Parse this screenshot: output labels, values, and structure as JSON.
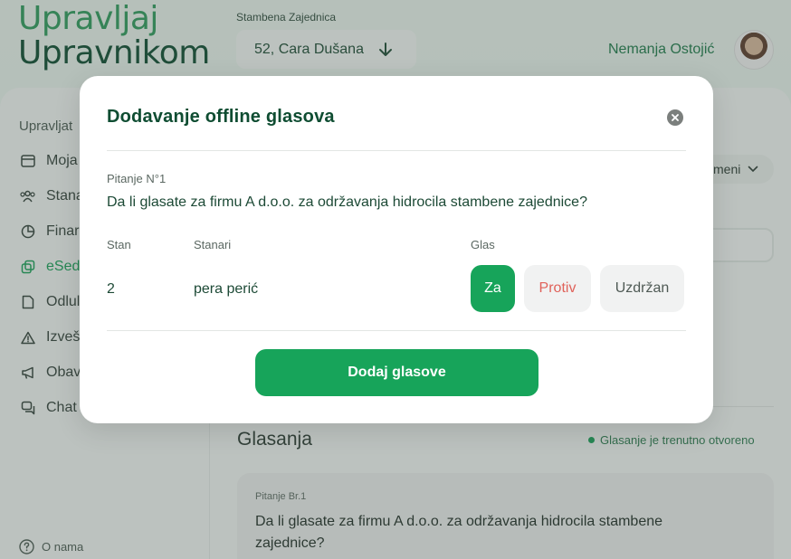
{
  "header": {
    "logo_line1": "Upravljaj",
    "logo_line2": "Upravnikom",
    "community_label": "Stambena Zajednica",
    "address": "52, Cara Dušana",
    "user_name": "Nemanja Ostojić"
  },
  "sidebar": {
    "title": "Upravljat",
    "items": [
      {
        "label": "Moja",
        "icon": "wallet-icon"
      },
      {
        "label": "Stana",
        "icon": "users-icon"
      },
      {
        "label": "Finar",
        "icon": "pie-chart-icon"
      },
      {
        "label": "eSed",
        "icon": "copy-icon"
      },
      {
        "label": "Odlul",
        "icon": "document-icon"
      },
      {
        "label": "Izveš",
        "icon": "warning-icon"
      },
      {
        "label": "Obav",
        "icon": "megaphone-icon"
      },
      {
        "label": "Chat",
        "icon": "chat-icon"
      }
    ],
    "about": "O nama"
  },
  "background": {
    "filter_label": "meni",
    "section_title": "Glasanja",
    "status_text": "Glasanje je trenutno otvoreno",
    "question_number": "Pitanje Br.1",
    "question_text": "Da li glasate za firmu A d.o.o. za održavanja hidrocila stambene zajednice?"
  },
  "modal": {
    "title": "Dodavanje offline glasova",
    "question_label": "Pitanje N°1",
    "question_text": "Da li glasate za firmu A d.o.o. za održavanja hidrocila stambene zajednice?",
    "columns": {
      "apartment": "Stan",
      "residents": "Stanari",
      "vote": "Glas"
    },
    "row": {
      "apartment": "2",
      "residents": "pera perić"
    },
    "vote_options": {
      "yes": "Za",
      "no": "Protiv",
      "abstain": "Uzdržan"
    },
    "selected_vote": "Za",
    "submit_label": "Dodaj glasove"
  },
  "colors": {
    "accent": "#17a45a",
    "title": "#0f4d32",
    "no_vote": "#e0625a"
  }
}
